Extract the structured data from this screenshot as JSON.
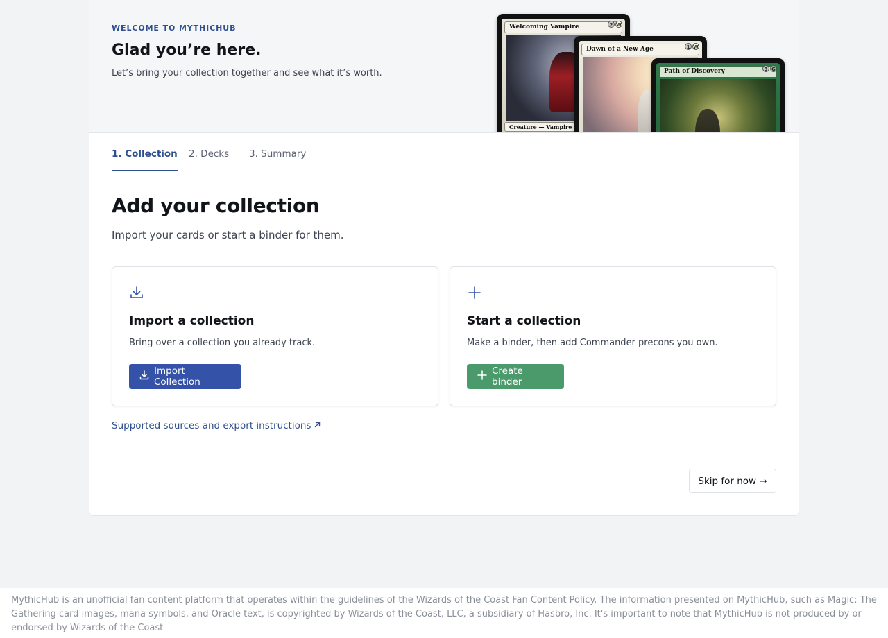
{
  "hero": {
    "eyebrow": "WELCOME TO MYTHICHUB",
    "title": "Glad you’re here.",
    "subtitle": "Let’s bring your collection together and see what it’s worth.",
    "cards": [
      {
        "name": "Welcoming Vampire",
        "mana": [
          "2",
          "W"
        ],
        "type": "Creature — Vampire",
        "color": "white"
      },
      {
        "name": "Dawn of a New Age",
        "mana": [
          "1",
          "W"
        ],
        "color": "white"
      },
      {
        "name": "Path of Discovery",
        "mana": [
          "3",
          "G"
        ],
        "color": "green"
      }
    ]
  },
  "tabs": [
    {
      "label": "1. Collection",
      "active": true
    },
    {
      "label": "2. Decks",
      "active": false
    },
    {
      "label": "3. Summary",
      "active": false
    }
  ],
  "main": {
    "title": "Add your collection",
    "subtitle": "Import your cards or start a binder for them.",
    "import_card": {
      "icon": "download-icon",
      "title": "Import a collection",
      "description": "Bring over a collection you already track.",
      "button_label": "Import Collection"
    },
    "start_card": {
      "icon": "plus-icon",
      "title": "Start a collection",
      "description": "Make a binder, then add Commander precons you own.",
      "button_label": "Create binder"
    },
    "help_link": "Supported sources and export instructions",
    "skip_label": "Skip for now →"
  },
  "footer": {
    "text": "MythicHub is an unofficial fan content platform that operates within the guidelines of the Wizards of the Coast Fan Content Policy. The information presented on MythicHub, such as Magic: The Gathering card images, mana symbols, and Oracle text, is copyrighted by Wizards of the Coast, LLC, a subsidiary of Hasbro, Inc. It's important to note that MythicHub is not produced by or endorsed by Wizards of the Coast"
  },
  "colors": {
    "accent": "#2f4f8f",
    "primary_button": "#3452a8",
    "success_button": "#4a9a6c",
    "background": "#f2f3f5"
  }
}
